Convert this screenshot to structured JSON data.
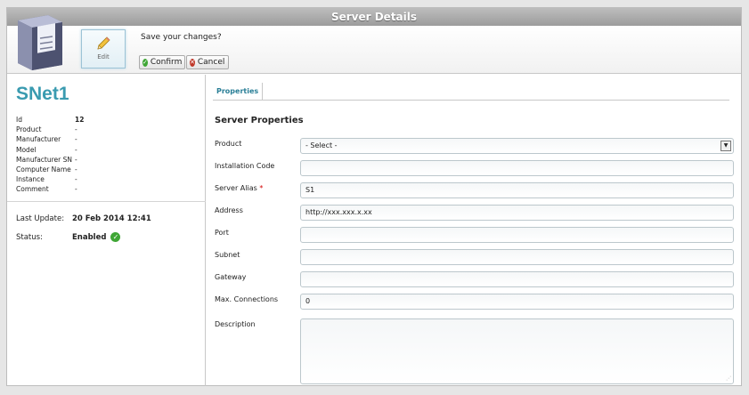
{
  "window": {
    "title": "Server Details"
  },
  "toolbar": {
    "edit_label": "Edit",
    "save_question": "Save your changes?",
    "confirm_label": "Confirm",
    "cancel_label": "Cancel"
  },
  "server": {
    "name": "SNet1",
    "info": [
      {
        "key": "Id",
        "value": "12"
      },
      {
        "key": "Product",
        "value": "-"
      },
      {
        "key": "Manufacturer",
        "value": "-"
      },
      {
        "key": "Model",
        "value": "-"
      },
      {
        "key": "Manufacturer SN",
        "value": "-"
      },
      {
        "key": "Computer Name",
        "value": "-"
      },
      {
        "key": "Instance",
        "value": "-"
      },
      {
        "key": "Comment",
        "value": "-"
      }
    ],
    "last_update_label": "Last Update:",
    "last_update_value": "20 Feb 2014 12:41",
    "status_label": "Status:",
    "status_value": "Enabled"
  },
  "tabs": [
    {
      "label": "Properties",
      "active": true
    }
  ],
  "form": {
    "section_title": "Server Properties",
    "product": {
      "label": "Product",
      "value": "- Select -"
    },
    "installation_code": {
      "label": "Installation Code",
      "value": ""
    },
    "server_alias": {
      "label": "Server Alias",
      "required_mark": "*",
      "value": "S1"
    },
    "address": {
      "label": "Address",
      "value": "http://xxx.xxx.x.xx"
    },
    "port": {
      "label": "Port",
      "value": ""
    },
    "subnet": {
      "label": "Subnet",
      "value": ""
    },
    "gateway": {
      "label": "Gateway",
      "value": ""
    },
    "max_connections": {
      "label": "Max. Connections",
      "value": "0"
    },
    "description": {
      "label": "Description",
      "value": ""
    }
  },
  "colors": {
    "accent": "#3a9bb0",
    "title_bar": "#a8a8a8",
    "status_ok": "#3fa635",
    "cancel_red": "#c0392b"
  }
}
